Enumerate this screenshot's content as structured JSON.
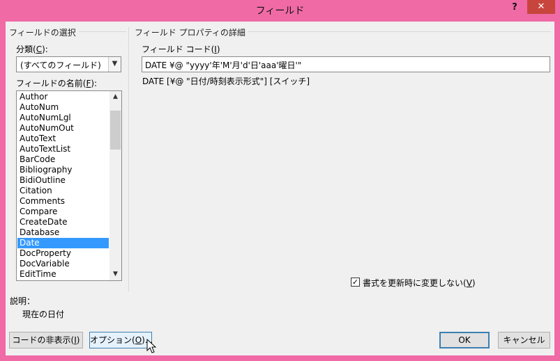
{
  "window": {
    "title": "フィールド",
    "help_label": "?",
    "close_label": "✕",
    "accent_color": "#f06aa6"
  },
  "left": {
    "group_title": "フィールドの選択",
    "category_label_prefix": "分類(",
    "category_mnemonic": "C",
    "category_label_suffix": "):",
    "category_value": "(すべてのフィールド)",
    "names_label_prefix": "フィールドの名前(",
    "names_mnemonic": "F",
    "names_label_suffix": "):",
    "field_names": [
      "Author",
      "AutoNum",
      "AutoNumLgl",
      "AutoNumOut",
      "AutoText",
      "AutoTextList",
      "BarCode",
      "Bibliography",
      "BidiOutline",
      "Citation",
      "Comments",
      "Compare",
      "CreateDate",
      "Database",
      "Date",
      "DocProperty",
      "DocVariable",
      "EditTime"
    ],
    "selected_field": "Date"
  },
  "right": {
    "group_title": "フィールド プロパティの詳細",
    "code_label_prefix": "フィールド コード(",
    "code_mnemonic": "I",
    "code_label_suffix": ")",
    "code_value": "DATE  ¥@ \"yyyy'年'M'月'd'日'aaa'曜日'\"",
    "syntax": "DATE [¥@ \"日付/時刻表示形式\"] [スイッチ]",
    "preserve_format_label_prefix": "書式を更新時に変更しない(",
    "preserve_format_mnemonic": "V",
    "preserve_format_label_suffix": ")",
    "preserve_format_checked": true
  },
  "description": {
    "label": "説明：",
    "text": "現在の日付"
  },
  "buttons": {
    "hide_codes_prefix": "コードの非表示(",
    "hide_codes_mnemonic": "I",
    "hide_codes_suffix": ")",
    "options_prefix": "オプション(",
    "options_mnemonic": "O",
    "options_suffix": ")...",
    "ok": "OK",
    "cancel": "キャンセル"
  }
}
